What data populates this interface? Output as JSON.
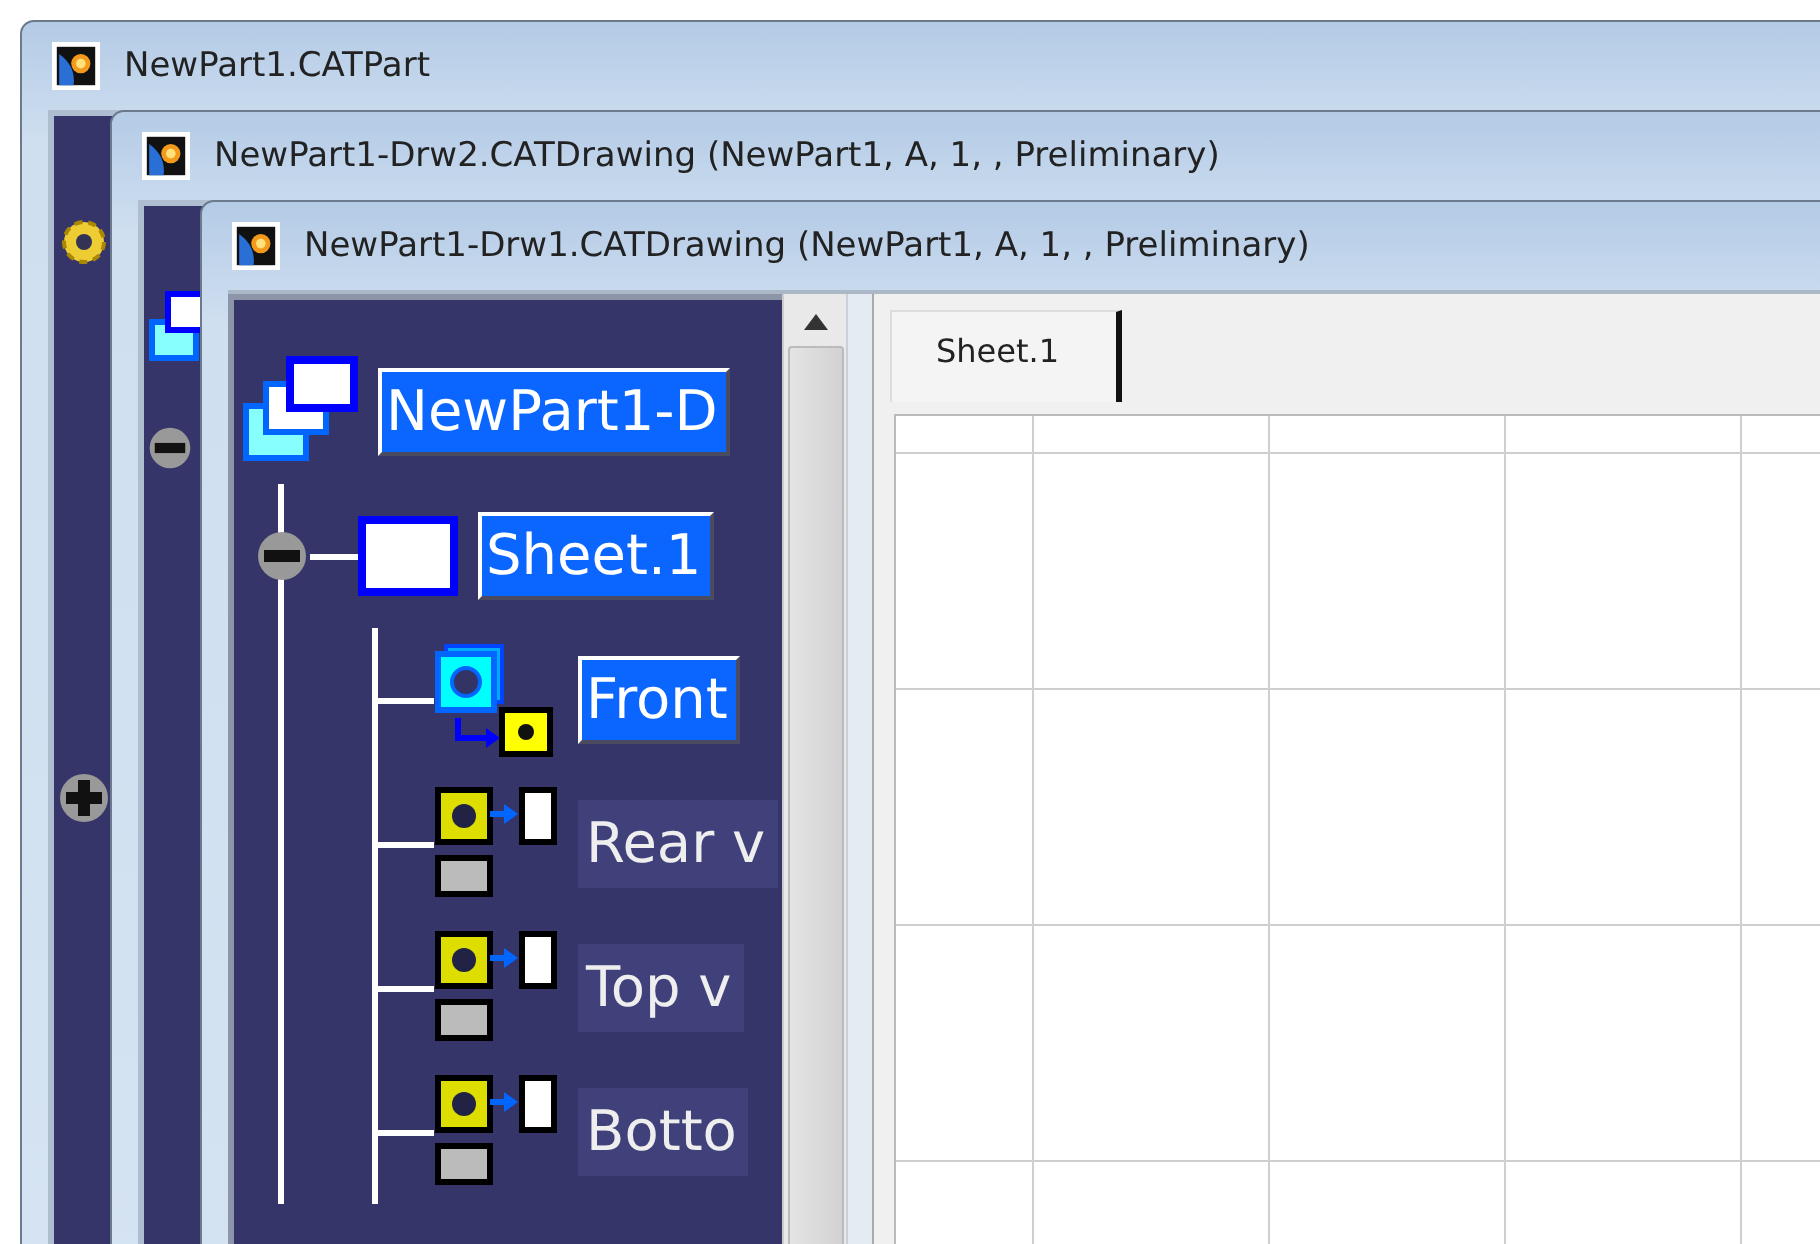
{
  "windows": [
    {
      "title": "NewPart1.CATPart"
    },
    {
      "title": "NewPart1-Drw2.CATDrawing (NewPart1, A, 1, , Preliminary)"
    },
    {
      "title": "NewPart1-Drw1.CATDrawing (NewPart1, A, 1, , Preliminary)"
    }
  ],
  "tree": [
    {
      "label": "NewPart1-D",
      "kind": "drawing",
      "selected": true,
      "children": [
        {
          "label": "Sheet.1",
          "kind": "sheet",
          "selected": true,
          "expanded": true,
          "children": [
            {
              "label": "Front",
              "kind": "active_view",
              "selected": true
            },
            {
              "label": "Rear v",
              "kind": "view",
              "selected": false
            },
            {
              "label": "Top v",
              "kind": "view",
              "selected": false
            },
            {
              "label": "Botto",
              "kind": "view",
              "selected": false
            }
          ]
        }
      ]
    }
  ],
  "tabs": [
    {
      "label": "Sheet.1",
      "selected": true
    }
  ]
}
